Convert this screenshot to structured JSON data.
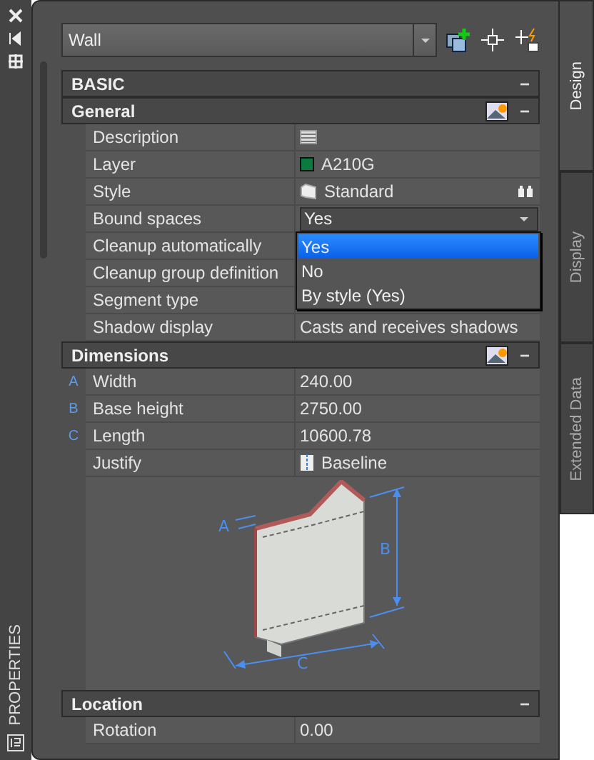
{
  "side_strip": {
    "title": "PROPERTIES"
  },
  "object_selector": {
    "value": "Wall"
  },
  "tabs": [
    {
      "label": "Design",
      "selected": true
    },
    {
      "label": "Display",
      "selected": false
    },
    {
      "label": "Extended Data",
      "selected": false
    }
  ],
  "sections": [
    {
      "title": "BASIC",
      "toggle": "−",
      "tool_icon": false
    },
    {
      "title": "General",
      "toggle": "−",
      "tool_icon": true,
      "rows": [
        {
          "label": "Description",
          "kind": "table"
        },
        {
          "label": "Layer",
          "kind": "swatch",
          "value": "A210G",
          "color": "#0b7a3e"
        },
        {
          "label": "Style",
          "kind": "style",
          "value": "Standard"
        },
        {
          "label": "Bound spaces",
          "kind": "combo",
          "value": "Yes"
        },
        {
          "label": "Cleanup automatically",
          "kind": "text"
        },
        {
          "label": "Cleanup group definition",
          "kind": "text"
        },
        {
          "label": "Segment type",
          "kind": "text"
        },
        {
          "label": "Shadow display",
          "kind": "text",
          "value": "Casts and receives shadows"
        }
      ]
    },
    {
      "title": "Dimensions",
      "toggle": "−",
      "tool_icon": true,
      "rows": [
        {
          "marker": "A",
          "label": "Width",
          "kind": "text",
          "value": "240.00"
        },
        {
          "marker": "B",
          "label": "Base height",
          "kind": "text",
          "value": "2750.00"
        },
        {
          "marker": "C",
          "label": "Length",
          "kind": "text",
          "value": "10600.78"
        },
        {
          "label": "Justify",
          "kind": "justify",
          "value": "Baseline"
        },
        {
          "kind": "diagram",
          "labels": [
            "A",
            "B",
            "C"
          ]
        }
      ]
    },
    {
      "title": "Location",
      "toggle": "−",
      "tool_icon": false,
      "rows": [
        {
          "label": "Rotation",
          "kind": "text",
          "value": "0.00"
        }
      ]
    }
  ],
  "dropdown": {
    "options": [
      {
        "label": "Yes",
        "selected": true
      },
      {
        "label": "No",
        "selected": false
      },
      {
        "label": "By style (Yes)",
        "selected": false
      }
    ]
  }
}
